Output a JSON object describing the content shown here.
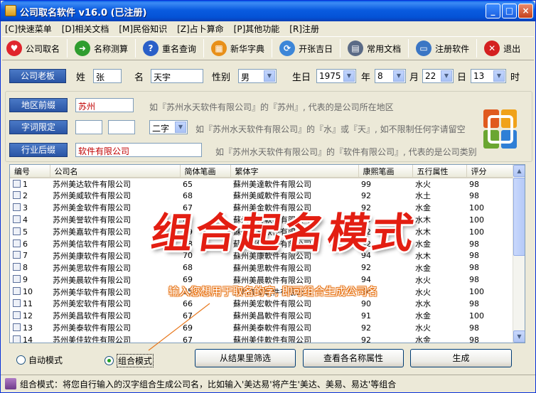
{
  "window": {
    "title": "公司取名软件 v16.0 (已注册)",
    "minimize": "_",
    "maximize": "□",
    "close": "×"
  },
  "menu": [
    "[C]快速菜单",
    "[D]相关文档",
    "[M]民俗知识",
    "[Z]占卜算命",
    "[P]其他功能",
    "[R]注册"
  ],
  "toolbar": [
    {
      "label": "公司取名",
      "icon": "heart-icon",
      "color": "#e0242c",
      "glyph": "♥"
    },
    {
      "label": "名称测算",
      "icon": "arrow-right-icon",
      "color": "#2f9d2f",
      "glyph": "➜"
    },
    {
      "label": "重名查询",
      "icon": "help-icon",
      "color": "#2a5fc8",
      "glyph": "?"
    },
    {
      "label": "新华字典",
      "icon": "windows-flag-icon",
      "color": "#e8901a",
      "glyph": "▦"
    },
    {
      "label": "开张吉日",
      "icon": "refresh-icon",
      "color": "#3c86d8",
      "glyph": "⟳"
    },
    {
      "label": "常用文档",
      "icon": "document-icon",
      "color": "#5b6b86",
      "glyph": "▤"
    },
    {
      "label": "注册软件",
      "icon": "computer-icon",
      "color": "#3b76c4",
      "glyph": "▭"
    },
    {
      "label": "退出",
      "icon": "close-x-icon",
      "color": "#d42020",
      "glyph": "✕"
    }
  ],
  "boss": {
    "button": "公司老板",
    "surname_label": "姓",
    "surname_value": "张",
    "given_label": "名",
    "given_value": "天宇",
    "gender_label": "性别",
    "gender_value": "男",
    "birthday_label": "生日",
    "year_value": "1975",
    "year_unit": "年",
    "month_value": "8",
    "month_unit": "月",
    "day_value": "22",
    "day_unit": "日",
    "hour_value": "13",
    "hour_unit": "时"
  },
  "prefix": {
    "button": "地区前缀",
    "value": "苏州",
    "hint": "如『苏州水天软件有限公司』的『苏州』, 代表的是公司所在地区"
  },
  "charlimit": {
    "button": "字词限定",
    "value1": "",
    "value2": "",
    "select": "二字",
    "hint": "如『苏州水天软件有限公司』的『水』或『天』, 如不限制任何字请留空"
  },
  "suffix": {
    "button": "行业后缀",
    "value": "软件有限公司",
    "hint": "如『苏州水天软件有限公司』的『软件有限公司』, 代表的是公司类别"
  },
  "logo_icon": "office-logo-icon",
  "table": {
    "headers": [
      "编号",
      "公司名",
      "简体笔画",
      "繁体字",
      "康熙笔画",
      "五行属性",
      "评分"
    ],
    "rows": [
      [
        "1",
        "苏州美达软件有限公司",
        "65",
        "蘇州美達軟件有限公司",
        "99",
        "水火",
        "98"
      ],
      [
        "2",
        "苏州美威软件有限公司",
        "68",
        "蘇州美威軟件有限公司",
        "92",
        "水土",
        "98"
      ],
      [
        "3",
        "苏州美金软件有限公司",
        "67",
        "蘇州美金軟件有限公司",
        "92",
        "水金",
        "100"
      ],
      [
        "4",
        "苏州美誉软件有限公司",
        "67",
        "蘇州美譽軟件有限公司",
        "99",
        "水木",
        "100"
      ],
      [
        "5",
        "苏州美嘉软件有限公司",
        "69",
        "蘇州美嘉軟件有限公司",
        "92",
        "水木",
        "100"
      ],
      [
        "6",
        "苏州美信软件有限公司",
        "68",
        "蘇州美信軟件有限公司",
        "92",
        "水金",
        "98"
      ],
      [
        "7",
        "苏州美康软件有限公司",
        "70",
        "蘇州美康軟件有限公司",
        "94",
        "水木",
        "98"
      ],
      [
        "8",
        "苏州美思软件有限公司",
        "68",
        "蘇州美思軟件有限公司",
        "92",
        "水金",
        "98"
      ],
      [
        "9",
        "苏州美晨软件有限公司",
        "69",
        "蘇州美晨軟件有限公司",
        "94",
        "水火",
        "98"
      ],
      [
        "10",
        "苏州美华软件有限公司",
        "65",
        "蘇州美華軟件有限公司",
        "94",
        "水火",
        "100"
      ],
      [
        "11",
        "苏州美宏软件有限公司",
        "66",
        "蘇州美宏軟件有限公司",
        "90",
        "水水",
        "98"
      ],
      [
        "12",
        "苏州美昌软件有限公司",
        "67",
        "蘇州美昌軟件有限公司",
        "91",
        "水金",
        "100"
      ],
      [
        "13",
        "苏州美泰软件有限公司",
        "69",
        "蘇州美泰軟件有限公司",
        "92",
        "水火",
        "98"
      ],
      [
        "14",
        "苏州美佳软件有限公司",
        "67",
        "蘇州美佳軟件有限公司",
        "92",
        "水金",
        "98"
      ]
    ]
  },
  "overlay": {
    "title": "组合起名模式",
    "subtitle": "输入您想用于取名的字, 即可组合生成公司名"
  },
  "bottom": {
    "auto_mode": "自动模式",
    "combo_mode": "组合模式",
    "filter_button": "从结果里筛选",
    "view_button": "查看各名称属性",
    "generate_button": "生成"
  },
  "status": "组合模式：将您自行输入的汉字组合生成公司名，比如输入'美达易'将产生'美达、美易、易达'等组合"
}
